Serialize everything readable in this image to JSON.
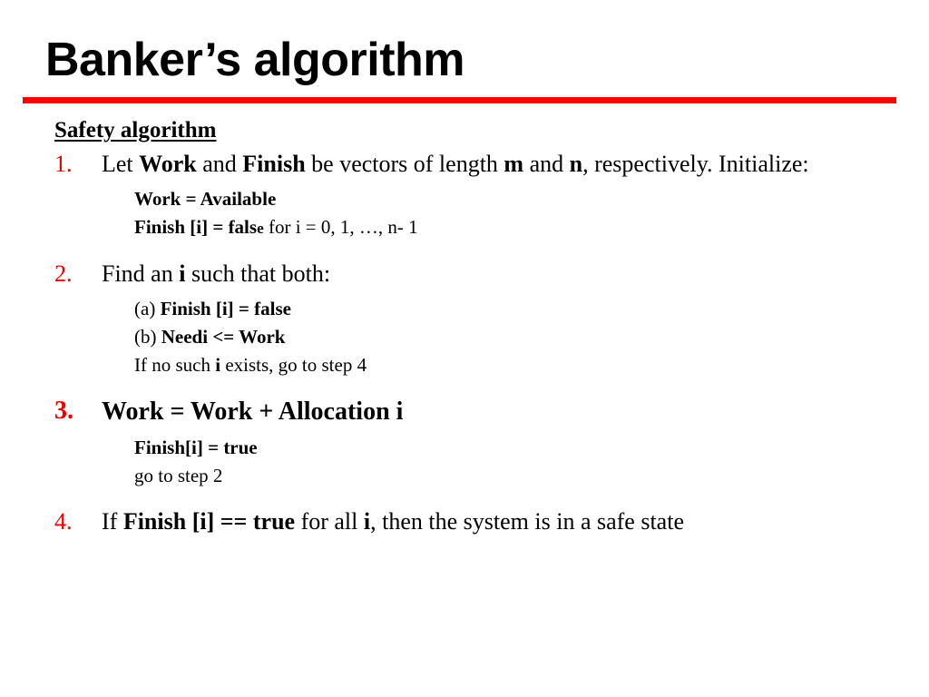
{
  "slide": {
    "title": "Banker’s algorithm",
    "accent_color": "#ff0000",
    "number_color": "#ee0000",
    "subhead": "Safety algorithm",
    "steps": [
      {
        "number": "1.",
        "text_parts": [
          {
            "t": "Let ",
            "bold": false
          },
          {
            "t": "Work",
            "bold": true
          },
          {
            "t": " and ",
            "bold": false
          },
          {
            "t": "Finish",
            "bold": true
          },
          {
            "t": " be vectors of length ",
            "bold": false
          },
          {
            "t": "m",
            "bold": true
          },
          {
            "t": " and ",
            "bold": false
          },
          {
            "t": "n",
            "bold": true
          },
          {
            "t": ", respectively.  Initialize:",
            "bold": false
          }
        ],
        "sub": [
          {
            "parts": [
              {
                "t": "Work = Available",
                "bold": true
              }
            ]
          },
          {
            "parts": [
              {
                "t": "Finish [i] = fals",
                "bold": true
              },
              {
                "t": "e",
                "bold": true,
                "small": true
              },
              {
                "t": " for i = 0, 1, …, n- 1",
                "bold": false
              }
            ]
          }
        ]
      },
      {
        "number": "2.",
        "text_parts": [
          {
            "t": "Find an ",
            "bold": false
          },
          {
            "t": "i",
            "bold": true
          },
          {
            "t": " such that both:",
            "bold": false
          }
        ],
        "sub": [
          {
            "parts": [
              {
                "t": "(a) ",
                "bold": false
              },
              {
                "t": "Finish [i] = false",
                "bold": true
              }
            ]
          },
          {
            "parts": [
              {
                "t": "(b) ",
                "bold": false
              },
              {
                "t": "Needi <= Work",
                "bold": true
              }
            ]
          },
          {
            "parts": [
              {
                "t": "If no such ",
                "bold": false
              },
              {
                "t": "i",
                "bold": true
              },
              {
                "t": " exists, go to step 4",
                "bold": false
              }
            ]
          }
        ]
      },
      {
        "number": "3.",
        "emphasis": true,
        "text_parts": [
          {
            "t": "Work = Work + Allocation i",
            "bold": true
          }
        ],
        "sub": [
          {
            "parts": [
              {
                "t": "Finish[i] = true",
                "bold": true
              }
            ]
          },
          {
            "parts": [
              {
                "t": "go to step 2",
                "bold": false
              }
            ]
          }
        ]
      },
      {
        "number": "4.",
        "text_parts": [
          {
            "t": "If ",
            "bold": false
          },
          {
            "t": "Finish [i] == true",
            "bold": true
          },
          {
            "t": " for all ",
            "bold": false
          },
          {
            "t": "i",
            "bold": true
          },
          {
            "t": ", then the system is in a safe state",
            "bold": false
          }
        ],
        "sub": []
      }
    ]
  }
}
